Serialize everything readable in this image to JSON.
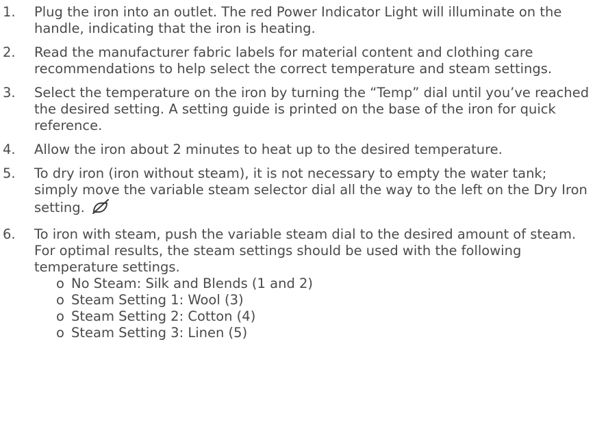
{
  "steps": [
    {
      "number": "1.",
      "text": "Plug the iron into an outlet. The red Power Indicator Light will illuminate on the handle, indicating that the iron is heating."
    },
    {
      "number": "2.",
      "text": "Read the manufacturer fabric labels for material content and clothing care recommendations to help select the correct temperature and steam settings."
    },
    {
      "number": "3.",
      "text": "Select the temperature on the iron by turning the “Temp” dial until you’ve reached the desired setting. A setting guide is printed on the base of the iron for quick reference."
    },
    {
      "number": "4.",
      "text": "Allow the iron about 2 minutes to heat up to the desired temperature."
    },
    {
      "number": "5.",
      "text": "To dry iron (iron without steam), it is not necessary to empty the water tank; simply move the variable steam selector dial all the way to the left on the Dry Iron setting.",
      "icon": "dry-iron-icon"
    },
    {
      "number": "6.",
      "text": "To iron with steam, push the variable steam dial to the desired amount of steam. For optimal results, the steam settings should be used with the following temperature settings.",
      "sub_bullet": "o",
      "sub_items": [
        "No Steam: Silk and Blends (1 and 2)",
        "Steam Setting 1: Wool (3)",
        "Steam Setting 2: Cotton (4)",
        "Steam Setting 3: Linen (5)"
      ]
    }
  ],
  "colors": {
    "text": "#4a4a4a",
    "background": "#ffffff"
  }
}
